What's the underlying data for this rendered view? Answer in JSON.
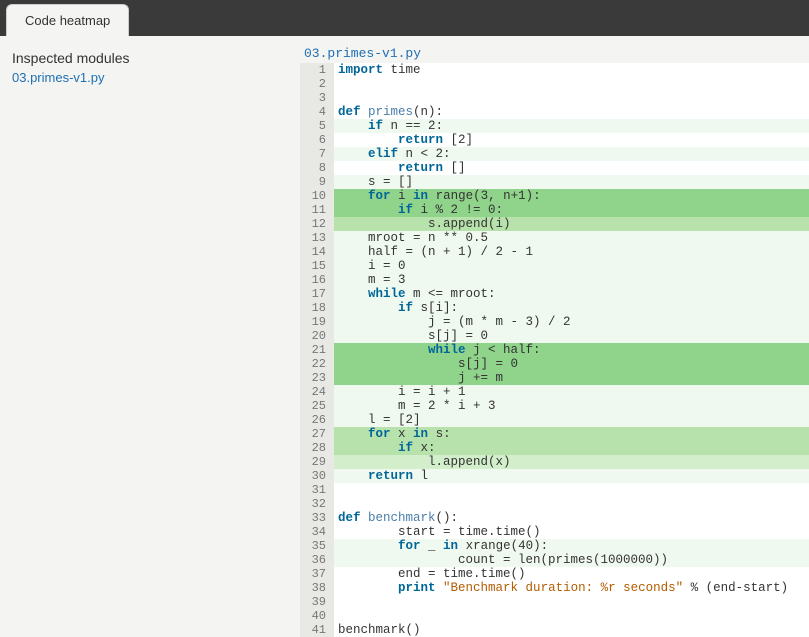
{
  "tab": {
    "label": "Code heatmap"
  },
  "sidebar": {
    "title": "Inspected modules",
    "modules": [
      "03.primes-v1.py"
    ]
  },
  "file": {
    "name": "03.primes-v1.py"
  },
  "code": {
    "lines": [
      {
        "n": 1,
        "heat": 0,
        "tokens": [
          [
            "kw",
            "import"
          ],
          [
            "",
            " time"
          ]
        ]
      },
      {
        "n": 2,
        "heat": 0,
        "tokens": []
      },
      {
        "n": 3,
        "heat": 0,
        "tokens": []
      },
      {
        "n": 4,
        "heat": 0,
        "tokens": [
          [
            "kw",
            "def"
          ],
          [
            "",
            " "
          ],
          [
            "def",
            "primes"
          ],
          [
            "",
            "(n):"
          ]
        ]
      },
      {
        "n": 5,
        "heat": 1,
        "tokens": [
          [
            "",
            "    "
          ],
          [
            "kw",
            "if"
          ],
          [
            "",
            " n == 2:"
          ]
        ]
      },
      {
        "n": 6,
        "heat": 0,
        "tokens": [
          [
            "",
            "        "
          ],
          [
            "kw",
            "return"
          ],
          [
            "",
            " [2]"
          ]
        ]
      },
      {
        "n": 7,
        "heat": 1,
        "tokens": [
          [
            "",
            "    "
          ],
          [
            "kw",
            "elif"
          ],
          [
            "",
            " n < 2:"
          ]
        ]
      },
      {
        "n": 8,
        "heat": 0,
        "tokens": [
          [
            "",
            "        "
          ],
          [
            "kw",
            "return"
          ],
          [
            "",
            " []"
          ]
        ]
      },
      {
        "n": 9,
        "heat": 1,
        "tokens": [
          [
            "",
            "    s = []"
          ]
        ]
      },
      {
        "n": 10,
        "heat": 5,
        "tokens": [
          [
            "",
            "    "
          ],
          [
            "kw",
            "for"
          ],
          [
            "",
            " i "
          ],
          [
            "kw",
            "in"
          ],
          [
            "",
            " range(3, n+1):"
          ]
        ]
      },
      {
        "n": 11,
        "heat": 5,
        "tokens": [
          [
            "",
            "        "
          ],
          [
            "kw",
            "if"
          ],
          [
            "",
            " i % 2 != 0:"
          ]
        ]
      },
      {
        "n": 12,
        "heat": 4,
        "tokens": [
          [
            "",
            "            s.append(i)"
          ]
        ]
      },
      {
        "n": 13,
        "heat": 1,
        "tokens": [
          [
            "",
            "    mroot = n ** 0.5"
          ]
        ]
      },
      {
        "n": 14,
        "heat": 1,
        "tokens": [
          [
            "",
            "    half = (n + 1) / 2 - 1"
          ]
        ]
      },
      {
        "n": 15,
        "heat": 1,
        "tokens": [
          [
            "",
            "    i = 0"
          ]
        ]
      },
      {
        "n": 16,
        "heat": 1,
        "tokens": [
          [
            "",
            "    m = 3"
          ]
        ]
      },
      {
        "n": 17,
        "heat": 1,
        "tokens": [
          [
            "",
            "    "
          ],
          [
            "kw",
            "while"
          ],
          [
            "",
            " m <= mroot:"
          ]
        ]
      },
      {
        "n": 18,
        "heat": 1,
        "tokens": [
          [
            "",
            "        "
          ],
          [
            "kw",
            "if"
          ],
          [
            "",
            " s[i]:"
          ]
        ]
      },
      {
        "n": 19,
        "heat": 1,
        "tokens": [
          [
            "",
            "            j = (m * m - 3) / 2"
          ]
        ]
      },
      {
        "n": 20,
        "heat": 1,
        "tokens": [
          [
            "",
            "            s[j] = 0"
          ]
        ]
      },
      {
        "n": 21,
        "heat": 5,
        "tokens": [
          [
            "",
            "            "
          ],
          [
            "kw",
            "while"
          ],
          [
            "",
            " j < half:"
          ]
        ]
      },
      {
        "n": 22,
        "heat": 5,
        "tokens": [
          [
            "",
            "                s[j] = 0"
          ]
        ]
      },
      {
        "n": 23,
        "heat": 5,
        "tokens": [
          [
            "",
            "                j += m"
          ]
        ]
      },
      {
        "n": 24,
        "heat": 1,
        "tokens": [
          [
            "",
            "        i = i + 1"
          ]
        ]
      },
      {
        "n": 25,
        "heat": 1,
        "tokens": [
          [
            "",
            "        m = 2 * i + 3"
          ]
        ]
      },
      {
        "n": 26,
        "heat": 1,
        "tokens": [
          [
            "",
            "    l = [2]"
          ]
        ]
      },
      {
        "n": 27,
        "heat": 4,
        "tokens": [
          [
            "",
            "    "
          ],
          [
            "kw",
            "for"
          ],
          [
            "",
            " x "
          ],
          [
            "kw",
            "in"
          ],
          [
            "",
            " s:"
          ]
        ]
      },
      {
        "n": 28,
        "heat": 4,
        "tokens": [
          [
            "",
            "        "
          ],
          [
            "kw",
            "if"
          ],
          [
            "",
            " x:"
          ]
        ]
      },
      {
        "n": 29,
        "heat": 3,
        "tokens": [
          [
            "",
            "            l.append(x)"
          ]
        ]
      },
      {
        "n": 30,
        "heat": 1,
        "tokens": [
          [
            "",
            "    "
          ],
          [
            "kw",
            "return"
          ],
          [
            "",
            " l"
          ]
        ]
      },
      {
        "n": 31,
        "heat": 0,
        "tokens": []
      },
      {
        "n": 32,
        "heat": 0,
        "tokens": []
      },
      {
        "n": 33,
        "heat": 0,
        "tokens": [
          [
            "kw",
            "def"
          ],
          [
            "",
            " "
          ],
          [
            "def",
            "benchmark"
          ],
          [
            "",
            "():"
          ]
        ]
      },
      {
        "n": 34,
        "heat": 0,
        "tokens": [
          [
            "",
            "        start = time.time()"
          ]
        ]
      },
      {
        "n": 35,
        "heat": 1,
        "tokens": [
          [
            "",
            "        "
          ],
          [
            "kw",
            "for"
          ],
          [
            "",
            " _ "
          ],
          [
            "kw",
            "in"
          ],
          [
            "",
            " xrange(40):"
          ]
        ]
      },
      {
        "n": 36,
        "heat": 1,
        "tokens": [
          [
            "",
            "                count = len(primes(1000000))"
          ]
        ]
      },
      {
        "n": 37,
        "heat": 0,
        "tokens": [
          [
            "",
            "        end = time.time()"
          ]
        ]
      },
      {
        "n": 38,
        "heat": 0,
        "tokens": [
          [
            "",
            "        "
          ],
          [
            "kw",
            "print"
          ],
          [
            "",
            " "
          ],
          [
            "str",
            "\"Benchmark duration: %r seconds\""
          ],
          [
            "",
            " % (end-start)"
          ]
        ]
      },
      {
        "n": 39,
        "heat": 0,
        "tokens": []
      },
      {
        "n": 40,
        "heat": 0,
        "tokens": []
      },
      {
        "n": 41,
        "heat": 0,
        "tokens": [
          [
            "",
            "benchmark()"
          ]
        ]
      }
    ]
  }
}
